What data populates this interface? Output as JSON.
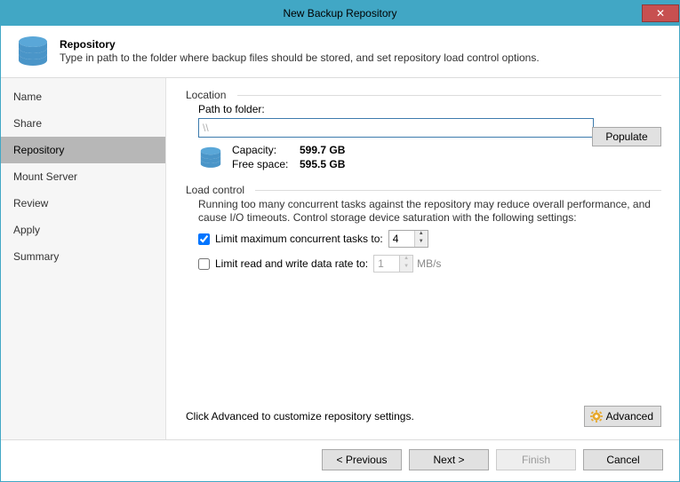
{
  "window": {
    "title": "New Backup Repository"
  },
  "header": {
    "title": "Repository",
    "description": "Type in path to the folder where backup files should be stored, and set repository load control options."
  },
  "sidebar": {
    "items": [
      {
        "label": "Name",
        "active": false
      },
      {
        "label": "Share",
        "active": false
      },
      {
        "label": "Repository",
        "active": true
      },
      {
        "label": "Mount Server",
        "active": false
      },
      {
        "label": "Review",
        "active": false
      },
      {
        "label": "Apply",
        "active": false
      },
      {
        "label": "Summary",
        "active": false
      }
    ]
  },
  "location": {
    "legend": "Location",
    "path_label": "Path to folder:",
    "path_value": "\\\\",
    "capacity_label": "Capacity:",
    "capacity_value": "599.7 GB",
    "free_label": "Free space:",
    "free_value": "595.5 GB",
    "populate_label": "Populate"
  },
  "load": {
    "legend": "Load control",
    "description": "Running too many concurrent tasks against the repository may reduce overall performance, and cause I/O timeouts. Control storage device saturation with the following settings:",
    "limit_tasks_label": "Limit maximum concurrent tasks to:",
    "limit_tasks_checked": true,
    "limit_tasks_value": "4",
    "limit_rate_label": "Limit read and write data rate to:",
    "limit_rate_checked": false,
    "limit_rate_value": "1",
    "limit_rate_unit": "MB/s"
  },
  "advanced": {
    "hint": "Click Advanced to customize repository settings.",
    "button": "Advanced"
  },
  "footer": {
    "previous": "< Previous",
    "next": "Next >",
    "finish": "Finish",
    "cancel": "Cancel"
  }
}
